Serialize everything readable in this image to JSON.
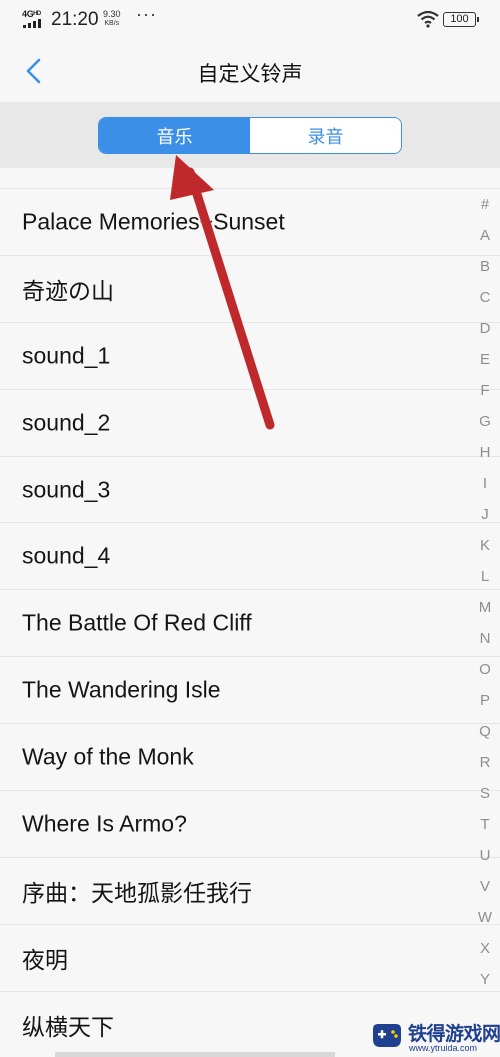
{
  "status_bar": {
    "network": "4Gᴴᴰ",
    "time": "21:20",
    "speed_value": "9.30",
    "speed_unit": "KB/s",
    "more": "···",
    "battery": "100"
  },
  "header": {
    "title": "自定义铃声",
    "back_icon": "chevron-left-icon"
  },
  "tabs": [
    {
      "label": "音乐",
      "active": true
    },
    {
      "label": "录音",
      "active": false
    }
  ],
  "songs": [
    "Palace Memories~Sunset",
    "奇迹の山",
    "sound_1",
    "sound_2",
    "sound_3",
    "sound_4",
    "The Battle Of Red Cliff",
    "The Wandering Isle",
    "Way of the Monk",
    "Where Is Armo?",
    "序曲：天地孤影任我行",
    "夜明",
    "纵横天下"
  ],
  "index_letters": [
    "#",
    "A",
    "B",
    "C",
    "D",
    "E",
    "F",
    "G",
    "H",
    "I",
    "J",
    "K",
    "L",
    "M",
    "N",
    "O",
    "P",
    "Q",
    "R",
    "S",
    "T",
    "U",
    "V",
    "W",
    "X",
    "Y"
  ],
  "annotation": {
    "color": "#c0292b"
  },
  "watermark": {
    "text": "铁得游戏网",
    "url": "www.ytruida.com"
  },
  "colors": {
    "accent": "#3b8fe6",
    "segment_bg": "#e8e8e8"
  }
}
